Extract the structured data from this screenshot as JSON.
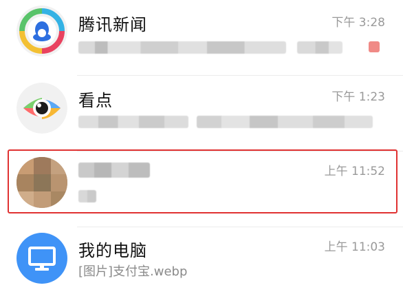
{
  "conversations": [
    {
      "title": "腾讯新闻",
      "time": "下午 3:28",
      "preview": "",
      "icon": "tencent-news-icon",
      "unread_badge": true
    },
    {
      "title": "看点",
      "time": "下午 1:23",
      "preview": "",
      "icon": "kandian-eye-icon"
    },
    {
      "title": "",
      "time": "上午 11:52",
      "preview": "",
      "icon": "blurred-avatar",
      "highlighted": true
    },
    {
      "title": "我的电脑",
      "time": "上午 11:03",
      "preview": "[图片]支付宝.webp",
      "icon": "monitor-icon"
    }
  ],
  "colors": {
    "highlight": "#e03131",
    "monitor_bg": "#3f93f7",
    "badge": "#f08a86"
  }
}
